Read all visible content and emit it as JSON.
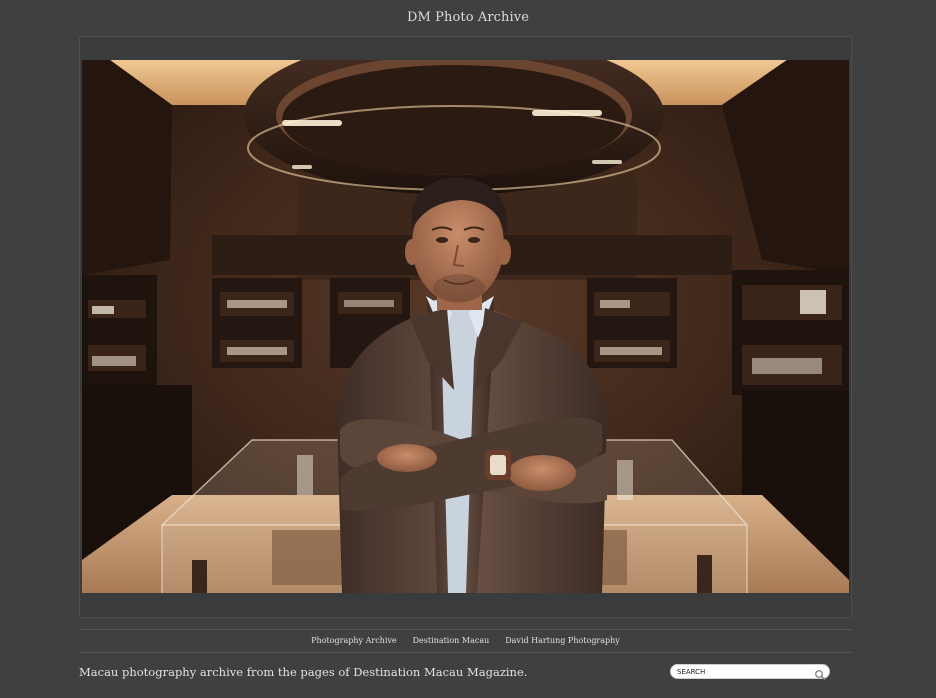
{
  "site": {
    "title": "DM Photo Archive"
  },
  "photo": {
    "alt": "Portrait of a man in a brown blazer with arms crossed inside a jewelry boutique",
    "palette": {
      "wall": "#3b2519",
      "ceiling_light": "#e2b57e",
      "floor": "#c49a72",
      "jacket": "#5a4338",
      "shirt": "#c9d3de",
      "skin": "#b07859"
    }
  },
  "footer": {
    "nav": [
      {
        "label": "Photography Archive"
      },
      {
        "label": "Destination Macau"
      },
      {
        "label": "David Hartung Photography"
      }
    ],
    "tagline": "Macau photography archive from the pages of Destination Macau Magazine."
  },
  "search": {
    "placeholder": "SEARCH",
    "icon": "magnifier-icon"
  },
  "colors": {
    "background": "#3f4041",
    "text": "#e0e0e0",
    "rule": "#535455"
  }
}
